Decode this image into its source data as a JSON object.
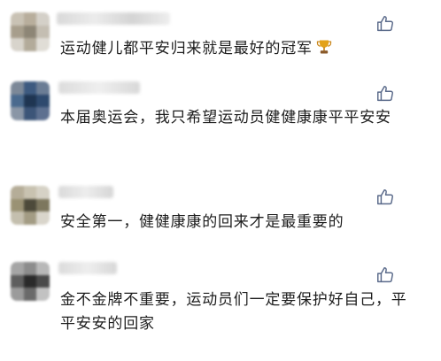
{
  "comments": [
    {
      "text": "运动健儿都平安归来就是最好的冠军",
      "emoji": "trophy-icon",
      "liked": false
    },
    {
      "text": "本届奥运会，我只希望运动员健健康康平平安安",
      "liked": false
    },
    {
      "text": "安全第一，健健康康的回来才是最重要的",
      "liked": false
    },
    {
      "text": "金不金牌不重要，运动员们一定要保护好自己，平平安安的回家",
      "liked": false
    }
  ],
  "colors": {
    "text": "#1d1d1d",
    "icon": "#5a6a8a",
    "trophy": "#e3a21a"
  }
}
